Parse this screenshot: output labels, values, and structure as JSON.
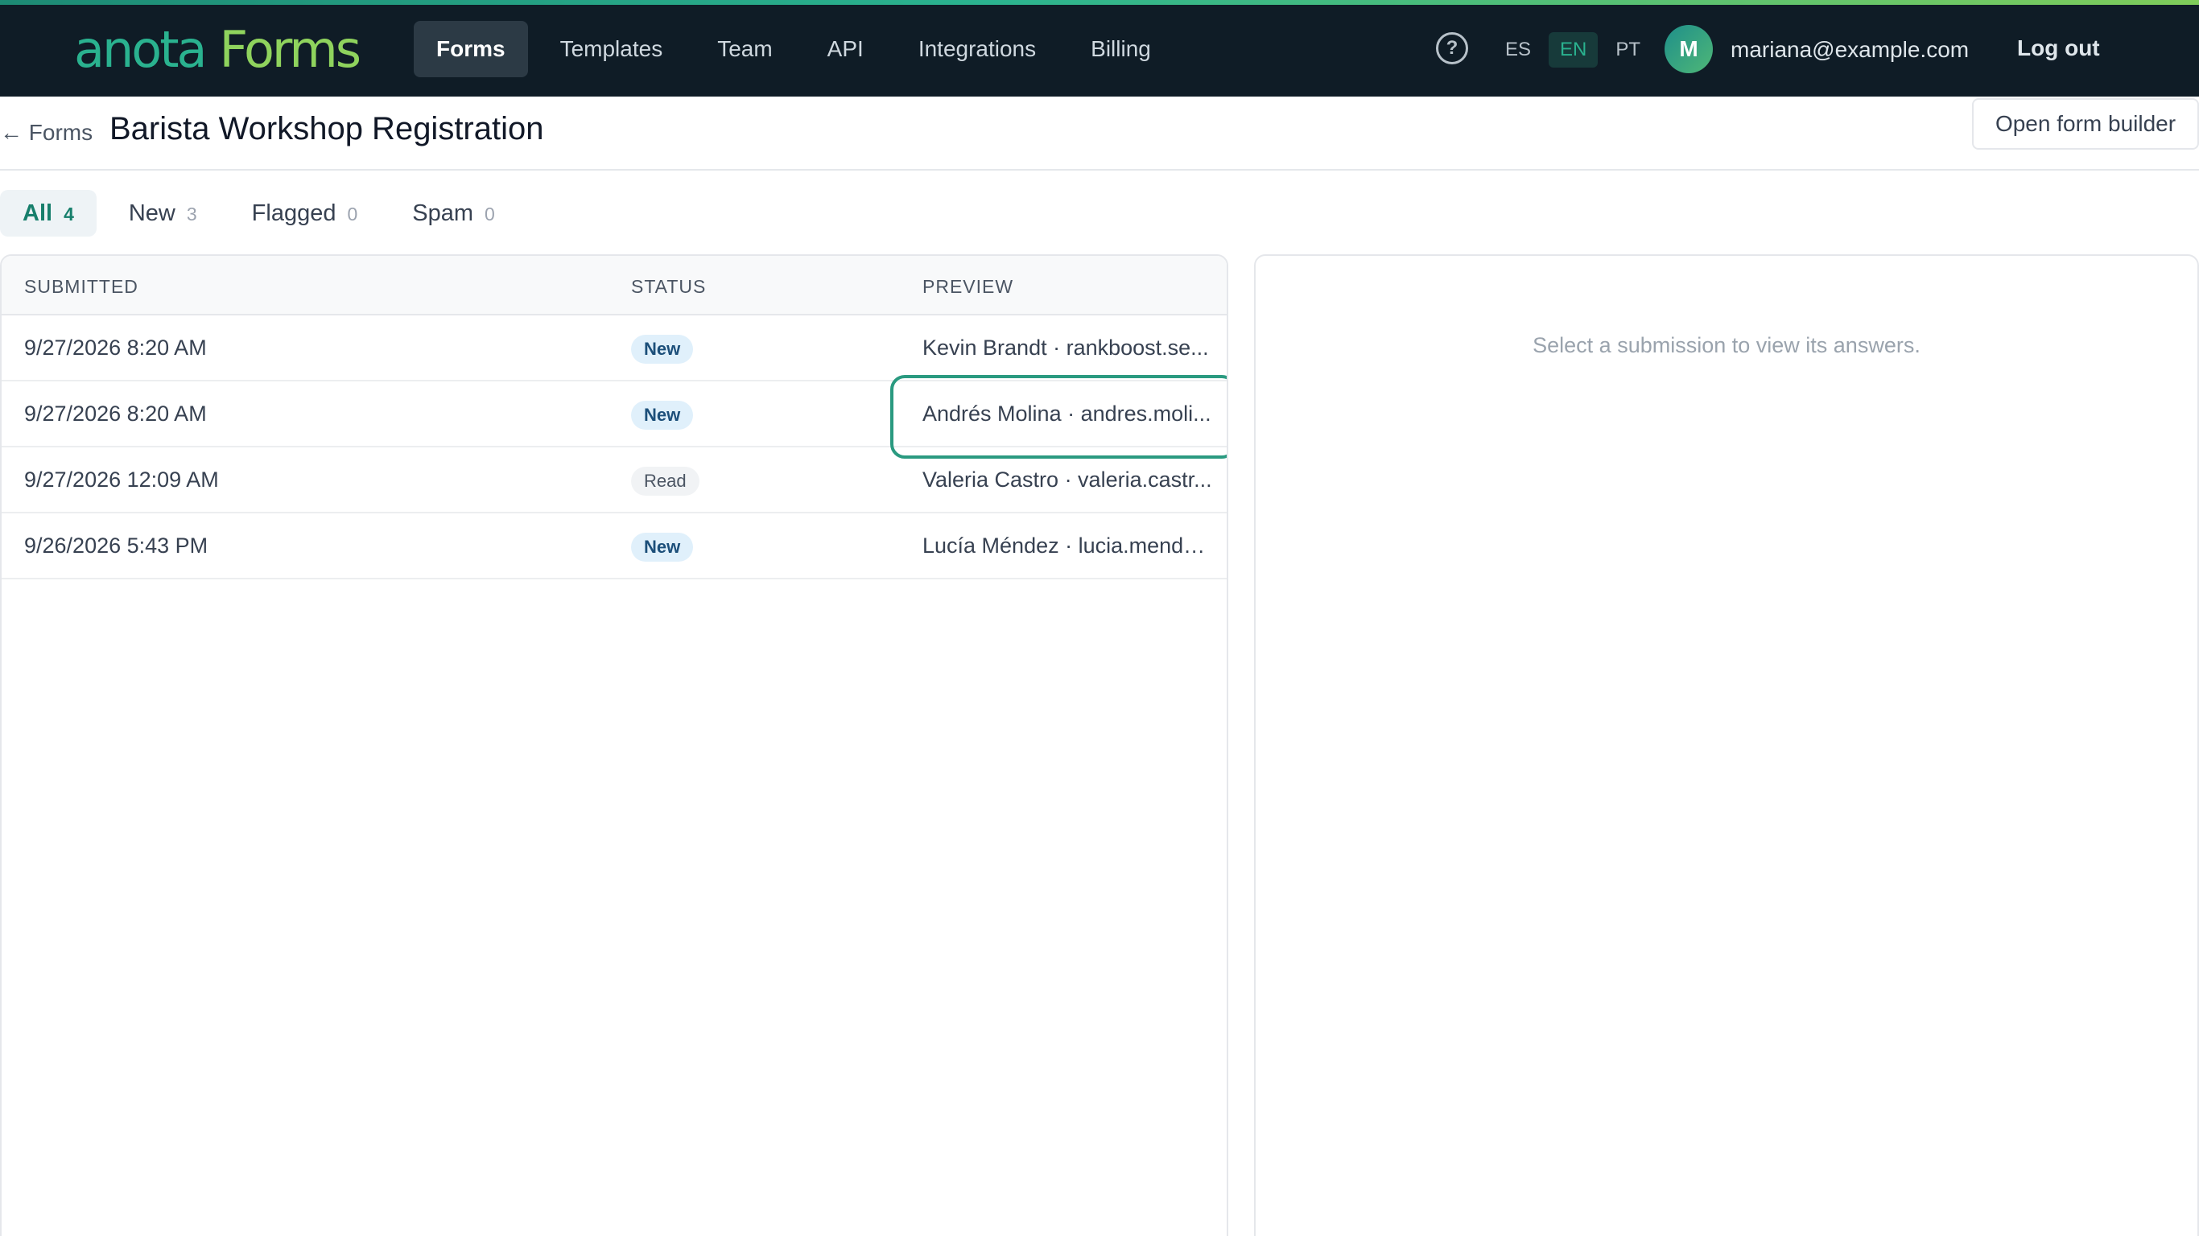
{
  "brand": {
    "name_part1": "anota",
    "name_part2": "Forms",
    "accent_color": "#2ab28f"
  },
  "nav": {
    "items": [
      {
        "label": "Forms",
        "active": true
      },
      {
        "label": "Templates",
        "active": false
      },
      {
        "label": "Team",
        "active": false
      },
      {
        "label": "API",
        "active": false
      },
      {
        "label": "Integrations",
        "active": false
      },
      {
        "label": "Billing",
        "active": false
      }
    ],
    "help_icon": "question-circle-icon",
    "help_glyph": "?",
    "languages": [
      {
        "code": "ES",
        "active": false
      },
      {
        "code": "EN",
        "active": true
      },
      {
        "code": "PT",
        "active": false
      }
    ],
    "user": {
      "initial": "M",
      "email": "mariana@example.com"
    },
    "logout_label": "Log out"
  },
  "header": {
    "back_label": "← Forms",
    "title": "Barista Workshop Registration",
    "open_builder_label": "Open form builder"
  },
  "tabs": [
    {
      "label": "All",
      "count": "4",
      "active": true
    },
    {
      "label": "New",
      "count": "3",
      "active": false
    },
    {
      "label": "Flagged",
      "count": "0",
      "active": false
    },
    {
      "label": "Spam",
      "count": "0",
      "active": false
    }
  ],
  "table": {
    "columns": {
      "submitted": "SUBMITTED",
      "status": "STATUS",
      "preview": "PREVIEW"
    },
    "rows": [
      {
        "submitted": "9/27/2026 8:20 AM",
        "status": "New",
        "preview": "Kevin Brandt · rankboost.se..."
      },
      {
        "submitted": "9/27/2026 8:20 AM",
        "status": "New",
        "preview": "Andrés Molina · andres.moli..."
      },
      {
        "submitted": "9/27/2026 12:09 AM",
        "status": "Read",
        "preview": "Valeria Castro · valeria.castr..."
      },
      {
        "submitted": "9/26/2026 5:43 PM",
        "status": "New",
        "preview": "Lucía Méndez · lucia.mende..."
      }
    ]
  },
  "detail": {
    "empty_message": "Select a submission to view its answers."
  }
}
